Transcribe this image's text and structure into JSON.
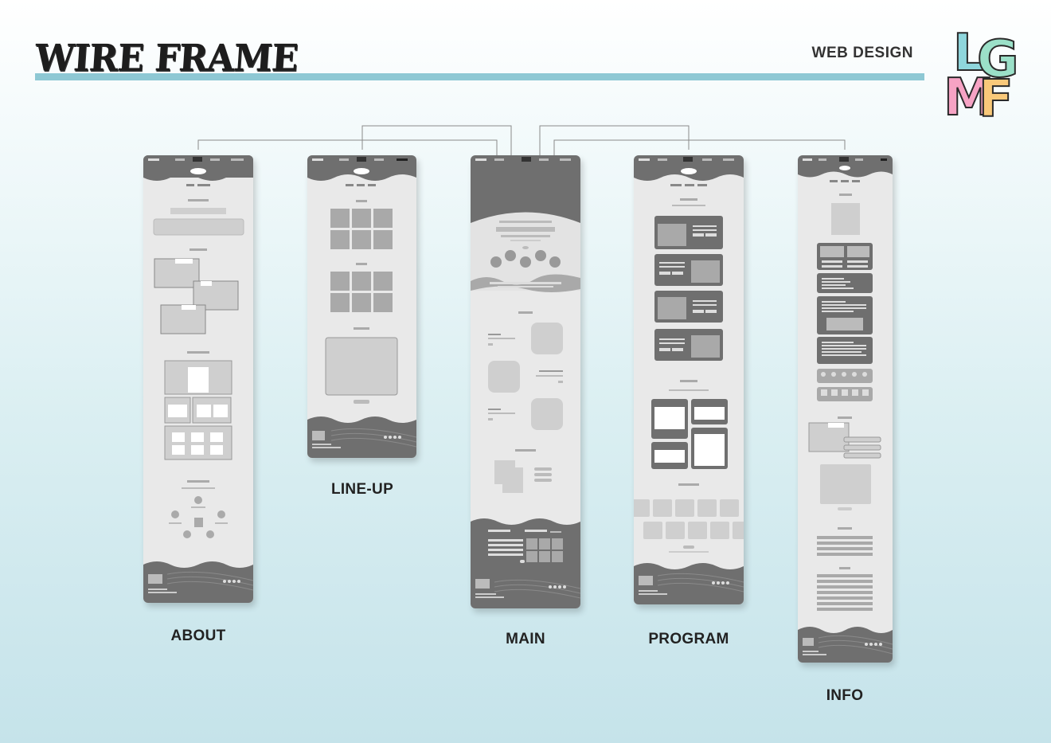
{
  "header": {
    "title": "WIRE FRAME",
    "subtitle": "WEB DESIGN"
  },
  "logo": {
    "letters": [
      "L",
      "G",
      "M",
      "F"
    ],
    "colors": [
      "#8fd6dc",
      "#9be0c8",
      "#f6a3c4",
      "#f9c97a"
    ]
  },
  "pages": [
    {
      "id": "about",
      "label": "ABOUT"
    },
    {
      "id": "lineup",
      "label": "LINE-UP"
    },
    {
      "id": "main",
      "label": "MAIN"
    },
    {
      "id": "program",
      "label": "PROGRAM"
    },
    {
      "id": "info",
      "label": "INFO"
    }
  ],
  "colors": {
    "accent_bar": "#8ec8d4",
    "wire_dark": "#6f6f6f",
    "wire_mid": "#a9a9a9",
    "wire_light": "#d4d4d4"
  }
}
